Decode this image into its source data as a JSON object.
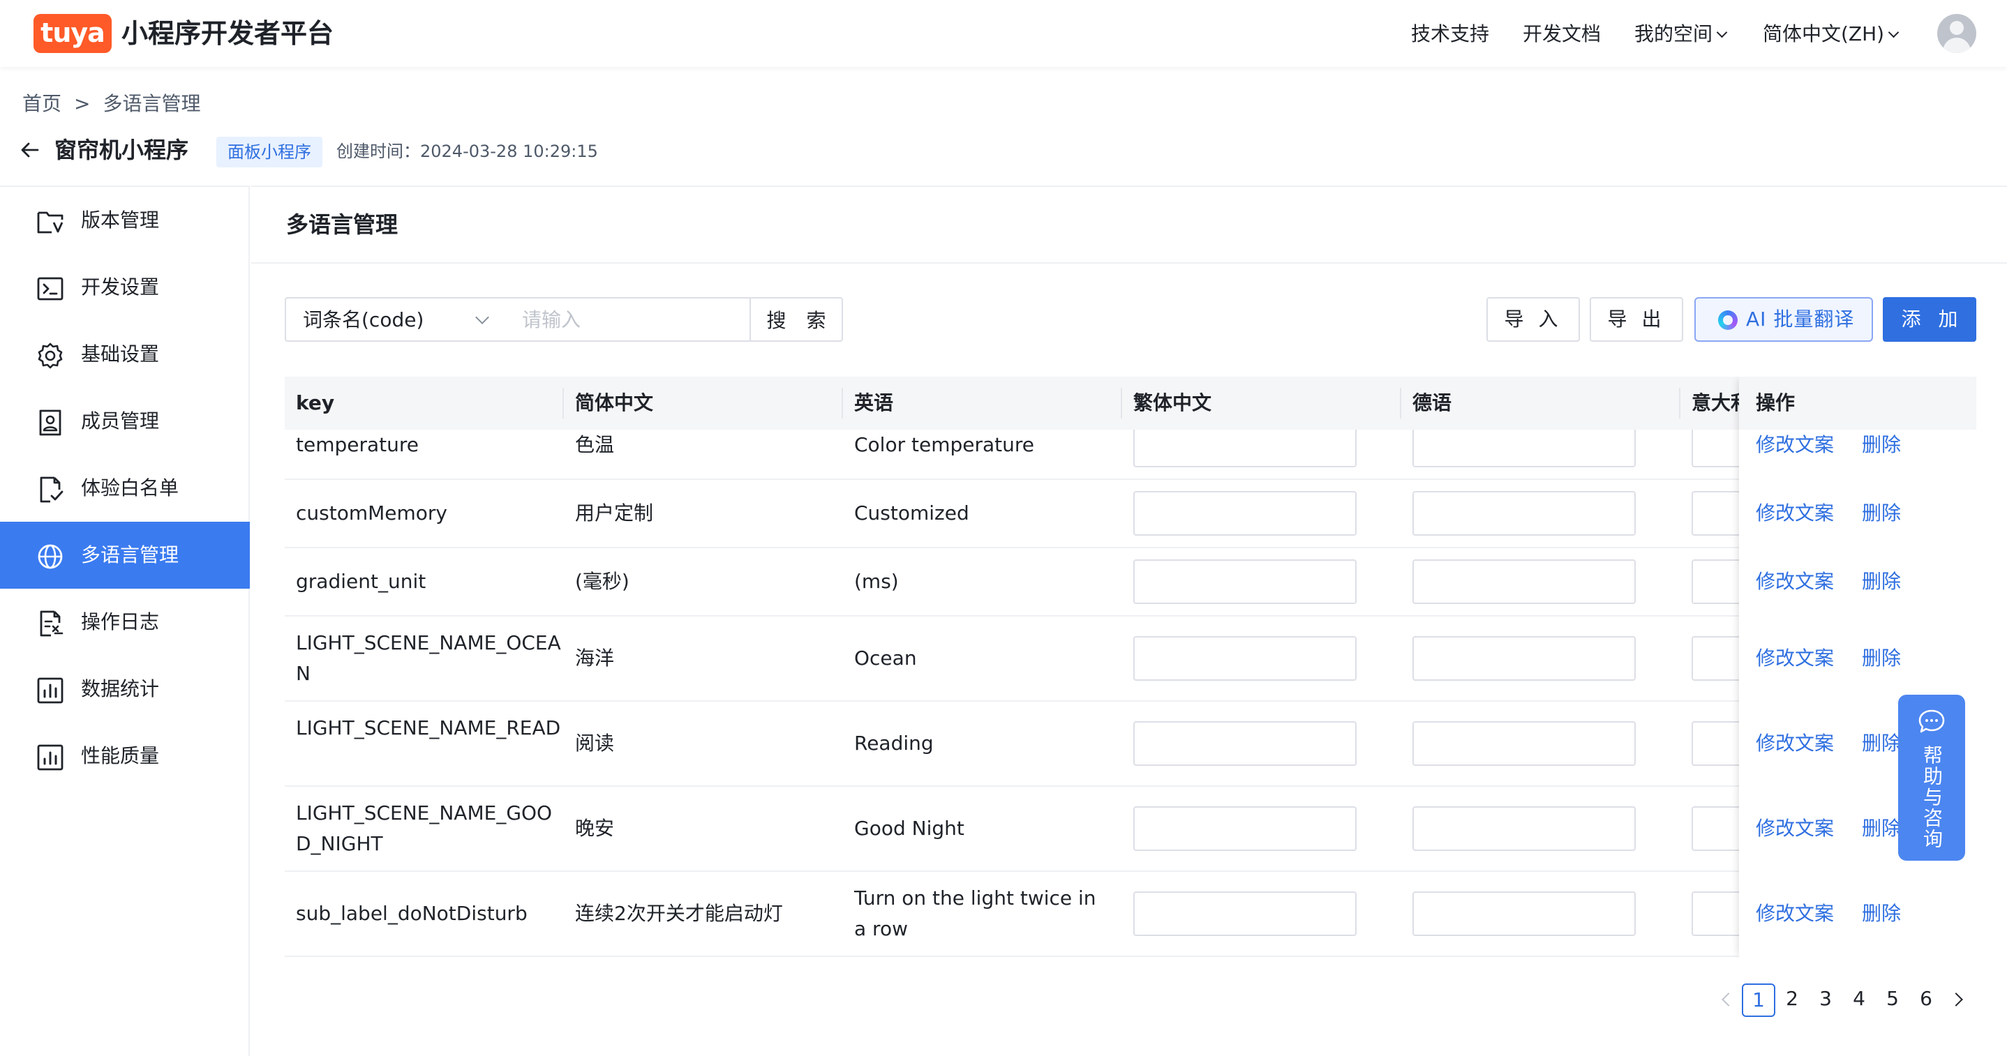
{
  "header": {
    "logo_text": "tuya",
    "platform_title": "小程序开发者平台",
    "nav": [
      {
        "label": "技术支持"
      },
      {
        "label": "开发文档"
      },
      {
        "label": "我的空间"
      },
      {
        "label": "简体中文(ZH)"
      }
    ]
  },
  "breadcrumb": {
    "home": "首页",
    "separator": ">",
    "current": "多语言管理"
  },
  "app": {
    "name": "窗帘机小程序",
    "type_tag": "面板小程序",
    "created_at": "创建时间：2024-03-28 10:29:15"
  },
  "sidebar": {
    "items": [
      {
        "label": "版本管理",
        "icon": "folder-version-icon"
      },
      {
        "label": "开发设置",
        "icon": "terminal-icon"
      },
      {
        "label": "基础设置",
        "icon": "gear-icon"
      },
      {
        "label": "成员管理",
        "icon": "member-badge-icon"
      },
      {
        "label": "体验白名单",
        "icon": "document-check-icon"
      },
      {
        "label": "多语言管理",
        "icon": "globe-icon"
      },
      {
        "label": "操作日志",
        "icon": "log-document-icon"
      },
      {
        "label": "数据统计",
        "icon": "bar-chart-icon"
      },
      {
        "label": "性能质量",
        "icon": "performance-chart-icon"
      }
    ],
    "active_index": 5
  },
  "main": {
    "title": "多语言管理",
    "filter": {
      "field_select": "词条名(code)",
      "input_placeholder": "请输入",
      "search_label": "搜 索"
    },
    "toolbar": {
      "import_label": "导 入",
      "export_label": "导 出",
      "ai_label": "AI 批量翻译",
      "add_label": "添 加"
    },
    "table": {
      "columns": [
        "key",
        "简体中文",
        "英语",
        "繁体中文",
        "德语",
        "意大利",
        "操作"
      ],
      "rows": [
        {
          "key": "temperature",
          "zh": "色温",
          "en": "Color temperature"
        },
        {
          "key": "customMemory",
          "zh": "用户定制",
          "en": "Customized"
        },
        {
          "key": "gradient_unit",
          "zh": "(毫秒)",
          "en": "(ms)"
        },
        {
          "key": "LIGHT_SCENE_NAME_OCEAN",
          "zh": "海洋",
          "en": "Ocean"
        },
        {
          "key": "LIGHT_SCENE_NAME_READ",
          "zh": "阅读",
          "en": "Reading"
        },
        {
          "key": "LIGHT_SCENE_NAME_GOOD_NIGHT",
          "zh": "晚安",
          "en": "Good Night"
        },
        {
          "key": "sub_label_doNotDisturb",
          "zh": "连续2次开关才能启动灯",
          "en": "Turn on the light twice in a row"
        }
      ],
      "actions": {
        "edit": "修改文案",
        "delete": "删除"
      }
    },
    "pagination": {
      "pages": [
        "1",
        "2",
        "3",
        "4",
        "5",
        "6"
      ],
      "current": "1"
    }
  },
  "help_float": {
    "label": "帮助与咨询"
  },
  "colors": {
    "brand": "#ff5a28",
    "primary": "#2f6fe0",
    "sidebar_active": "#3a7bf0"
  }
}
